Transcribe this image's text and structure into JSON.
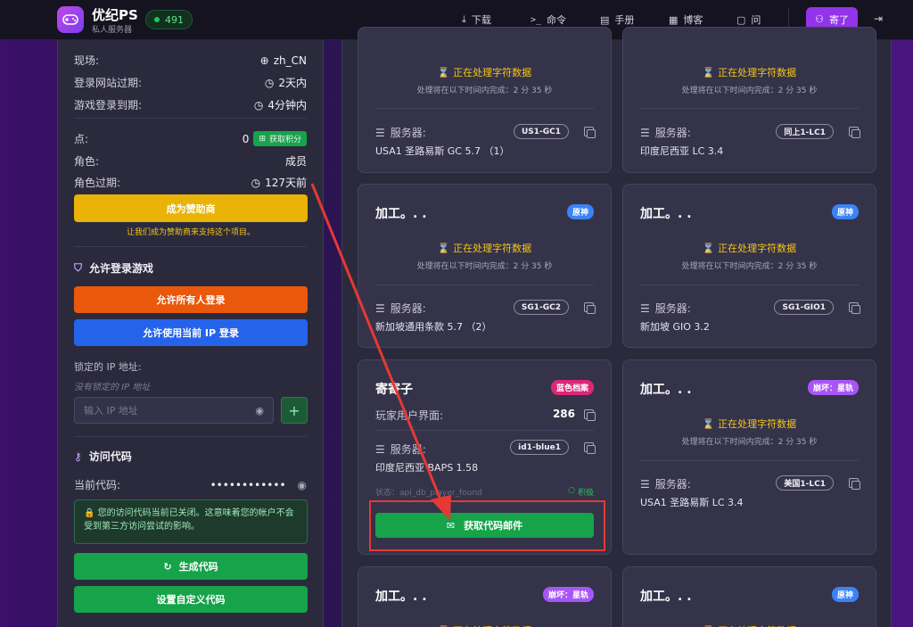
{
  "header": {
    "title": "优纪PS",
    "subtitle": "私人服务器",
    "online_count": "491",
    "nav": {
      "download": "下载",
      "commands": "命令",
      "manual": "手册",
      "blog": "博客",
      "ask": "问"
    },
    "user_label": "寄了"
  },
  "account": {
    "region_label": "现场:",
    "region_value": "zh_CN",
    "site_expiry_label": "登录网站过期:",
    "site_expiry_value": "2天内",
    "game_expiry_label": "游戏登录到期:",
    "game_expiry_value": "4分钟内",
    "points_label": "点:",
    "points_value": "0",
    "points_button": "获取积分",
    "role_label": "角色:",
    "role_value": "成员",
    "role_expiry_label": "角色过期:",
    "role_expiry_value": "127天前",
    "sponsor_button": "成为赞助商",
    "sponsor_note": "让我们成为赞助商来支持这个项目。"
  },
  "login_section": {
    "title": "允许登录游戏",
    "allow_all_button": "允许所有人登录",
    "allow_ip_button": "允许使用当前 IP 登录",
    "locked_ip_label": "锁定的 IP 地址:",
    "no_locked_ip": "没有锁定的 IP 地址",
    "ip_placeholder": "输入 IP 地址",
    "add_symbol": "+"
  },
  "access_code": {
    "title": "访问代码",
    "current_label": "当前代码:",
    "current_value": "••••••••••••",
    "notice": "您的访问代码当前已关闭。这意味着您的帐户不会受到第三方访问尝试的影响。",
    "generate_button": "生成代码",
    "custom_button": "设置自定义代码"
  },
  "cards": {
    "processing_text": "正在处理字符数据",
    "processing_sub": "处理将在以下时间内完成：2 分 35 秒",
    "server_label": "服务器:",
    "c1": {
      "server_code": "US1-GC1",
      "server_name": "USA1 圣路易斯 GC 5.7 （1）"
    },
    "c2": {
      "server_code": "同上1-LC1",
      "server_name": "印度尼西亚 LC 3.4"
    },
    "c3": {
      "title": "加工。. .",
      "tag": "原神",
      "server_code": "SG1-GC2",
      "server_name": "新加坡通用条款 5.7 （2）"
    },
    "c4": {
      "title": "加工。. .",
      "tag": "原神",
      "server_code": "SG1-GIO1",
      "server_name": "新加坡 GIO 3.2"
    },
    "c5": {
      "title": "寄寄子",
      "tag": "蓝色档案",
      "player_label": "玩家用户界面:",
      "player_value": "286",
      "server_code": "id1-blue1",
      "server_name": "印度尼西亚 BAPS 1.58",
      "status": "状态：api_db_player_found",
      "status_badge": "积极",
      "mail_button": "获取代码邮件"
    },
    "c6": {
      "title": "加工。. .",
      "tag": "崩坏：星轨",
      "server_code": "美国1-LC1",
      "server_name": "USA1 圣路易斯 LC 3.4"
    },
    "c7": {
      "title": "加工。. .",
      "tag": "崩坏：星轨"
    },
    "c8": {
      "title": "加工。. .",
      "tag": "原神"
    }
  },
  "colors": {
    "accent_purple": "#9333ea",
    "green": "#16a34a",
    "yellow": "#eab308",
    "orange": "#ea580c",
    "blue": "#2563eb",
    "highlight_red": "#e53935"
  }
}
